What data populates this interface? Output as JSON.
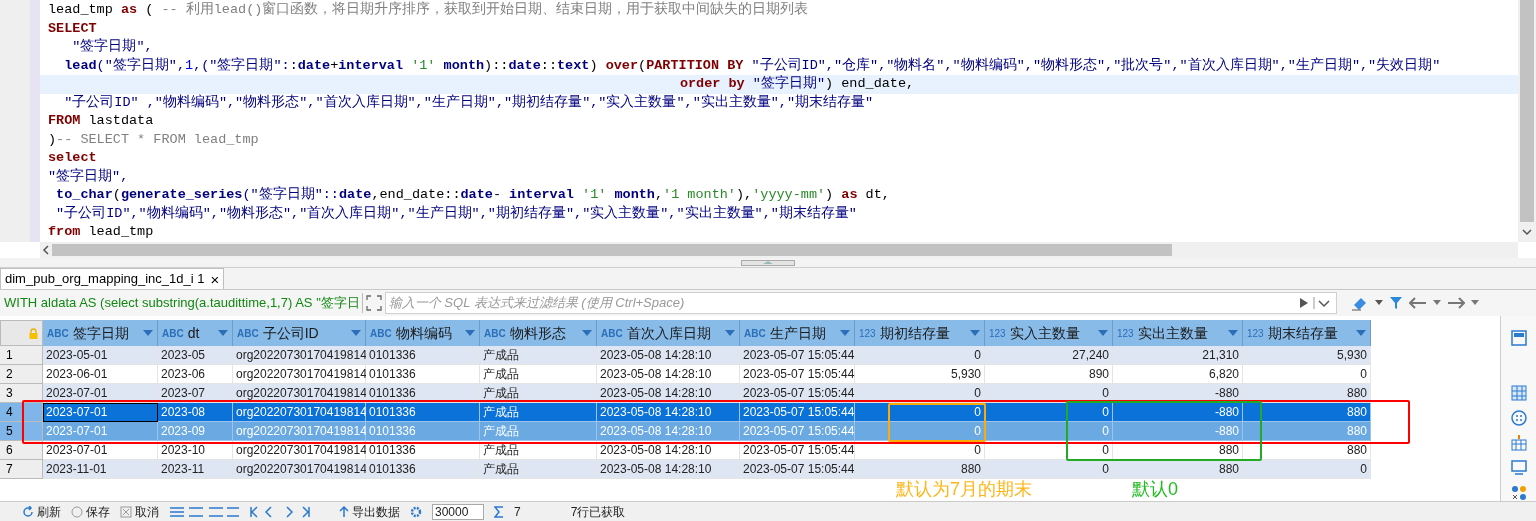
{
  "editor": {
    "lines": [
      {
        "highlighted": false,
        "segments": [
          {
            "kind": "plain",
            "text": "lead_tmp "
          },
          {
            "kind": "kw",
            "text": "as"
          },
          {
            "kind": "plain",
            "text": " ( "
          },
          {
            "kind": "comment",
            "text": "-- 利用lead()窗口函数，将日期升序排序，获取到开始日期、结束日期，用于获取中间缺失的日期列表"
          }
        ]
      },
      {
        "highlighted": false,
        "segments": [
          {
            "kind": "kw",
            "text": "SELECT"
          }
        ]
      },
      {
        "highlighted": false,
        "segments": [
          {
            "kind": "ident",
            "text": "   \"签字日期\","
          }
        ]
      },
      {
        "highlighted": false,
        "segments": [
          {
            "kind": "fn",
            "text": "  lead"
          },
          {
            "kind": "ident",
            "text": "(\"签字日期\","
          },
          {
            "kind": "num",
            "text": "1"
          },
          {
            "kind": "ident",
            "text": ",(\"签字日期\"::"
          },
          {
            "kind": "fn",
            "text": "date"
          },
          {
            "kind": "plain",
            "text": "+"
          },
          {
            "kind": "fn",
            "text": "interval "
          },
          {
            "kind": "str",
            "text": "'1'"
          },
          {
            "kind": "fn",
            "text": " month"
          },
          {
            "kind": "plain",
            "text": ")::"
          },
          {
            "kind": "fn",
            "text": "date"
          },
          {
            "kind": "plain",
            "text": "::"
          },
          {
            "kind": "fn",
            "text": "text"
          },
          {
            "kind": "plain",
            "text": ") "
          },
          {
            "kind": "kw",
            "text": "over"
          },
          {
            "kind": "plain",
            "text": "("
          },
          {
            "kind": "kw",
            "text": "PARTITION BY"
          },
          {
            "kind": "ident",
            "text": " \"子公司ID\",\"仓库\",\"物料名\",\"物料编码\",\"物料形态\",\"批次号\",\"首次入库日期\",\"生产日期\",\"失效日期\""
          }
        ]
      },
      {
        "highlighted": true,
        "segments": [
          {
            "kind": "kw",
            "text": "                                                                              order by"
          },
          {
            "kind": "ident",
            "text": " \"签字日期\""
          },
          {
            "kind": "plain",
            "text": ") end_date,"
          }
        ]
      },
      {
        "highlighted": false,
        "segments": [
          {
            "kind": "ident",
            "text": "  \"子公司ID\" ,\"物料编码\",\"物料形态\",\"首次入库日期\",\"生产日期\",\"期初结存量\",\"实入主数量\",\"实出主数量\",\"期末结存量\""
          }
        ]
      },
      {
        "highlighted": false,
        "segments": [
          {
            "kind": "kw",
            "text": "FROM"
          },
          {
            "kind": "plain",
            "text": " lastdata"
          }
        ]
      },
      {
        "highlighted": false,
        "segments": [
          {
            "kind": "plain",
            "text": ")"
          },
          {
            "kind": "comment",
            "text": "-- SELECT * FROM lead_tmp"
          }
        ]
      },
      {
        "highlighted": false,
        "segments": [
          {
            "kind": "kw",
            "text": "select"
          }
        ]
      },
      {
        "highlighted": false,
        "segments": [
          {
            "kind": "ident",
            "text": "\"签字日期\","
          }
        ]
      },
      {
        "highlighted": false,
        "segments": [
          {
            "kind": "fn",
            "text": " to_char"
          },
          {
            "kind": "plain",
            "text": "("
          },
          {
            "kind": "fn",
            "text": "generate_series"
          },
          {
            "kind": "ident",
            "text": "(\"签字日期\"::"
          },
          {
            "kind": "fn",
            "text": "date"
          },
          {
            "kind": "plain",
            "text": ",end_date::"
          },
          {
            "kind": "fn",
            "text": "date"
          },
          {
            "kind": "plain",
            "text": "- "
          },
          {
            "kind": "fn",
            "text": "interval "
          },
          {
            "kind": "str",
            "text": "'1'"
          },
          {
            "kind": "fn",
            "text": " month"
          },
          {
            "kind": "plain",
            "text": ","
          },
          {
            "kind": "str",
            "text": "'1 month'"
          },
          {
            "kind": "plain",
            "text": "),"
          },
          {
            "kind": "str",
            "text": "'yyyy-mm'"
          },
          {
            "kind": "plain",
            "text": ") "
          },
          {
            "kind": "kw",
            "text": "as"
          },
          {
            "kind": "plain",
            "text": " dt,"
          }
        ]
      },
      {
        "highlighted": false,
        "segments": [
          {
            "kind": "ident",
            "text": " \"子公司ID\",\"物料编码\",\"物料形态\",\"首次入库日期\",\"生产日期\",\"期初结存量\",\"实入主数量\",\"实出主数量\",\"期末结存量\""
          }
        ]
      },
      {
        "highlighted": false,
        "segments": [
          {
            "kind": "kw",
            "text": "from"
          },
          {
            "kind": "plain",
            "text": " lead_tmp"
          }
        ]
      }
    ]
  },
  "result_tab": {
    "label": "dim_pub_org_mapping_inc_1d_i 1",
    "close": "×"
  },
  "filter_bar": {
    "query": "WITH aldata AS (select substring(a.taudittime,1,7) AS \"签字日",
    "placeholder": "输入一个 SQL 表达式来过滤结果 (使用 Ctrl+Space)"
  },
  "table": {
    "columns": [
      {
        "name": "签字日期",
        "type_label": "ABC",
        "kind": "text"
      },
      {
        "name": "dt",
        "type_label": "ABC",
        "kind": "text"
      },
      {
        "name": "子公司ID",
        "type_label": "ABC",
        "kind": "text"
      },
      {
        "name": "物料编码",
        "type_label": "ABC",
        "kind": "text"
      },
      {
        "name": "物料形态",
        "type_label": "ABC",
        "kind": "text"
      },
      {
        "name": "首次入库日期",
        "type_label": "ABC",
        "kind": "text"
      },
      {
        "name": "生产日期",
        "type_label": "ABC",
        "kind": "text"
      },
      {
        "name": "期初结存量",
        "type_label": "123",
        "kind": "number"
      },
      {
        "name": "实入主数量",
        "type_label": "123",
        "kind": "number"
      },
      {
        "name": "实出主数量",
        "type_label": "123",
        "kind": "number"
      },
      {
        "name": "期末结存量",
        "type_label": "123",
        "kind": "number"
      }
    ],
    "rows": [
      {
        "number": "1",
        "selected": false,
        "current": false,
        "cells": [
          "2023-05-01",
          "2023-05",
          "org20220730170419814",
          "0101336",
          "产成品",
          "2023-05-08 14:28:10",
          "2023-05-07 15:05:44",
          "0",
          "27,240",
          "21,310",
          "5,930"
        ]
      },
      {
        "number": "2",
        "selected": false,
        "current": false,
        "cells": [
          "2023-06-01",
          "2023-06",
          "org20220730170419814",
          "0101336",
          "产成品",
          "2023-05-08 14:28:10",
          "2023-05-07 15:05:44",
          "5,930",
          "890",
          "6,820",
          "0"
        ]
      },
      {
        "number": "3",
        "selected": false,
        "current": false,
        "cells": [
          "2023-07-01",
          "2023-07",
          "org20220730170419814",
          "0101336",
          "产成品",
          "2023-05-08 14:28:10",
          "2023-05-07 15:05:44",
          "0",
          "0",
          "-880",
          "880"
        ]
      },
      {
        "number": "4",
        "selected": true,
        "current": true,
        "cells": [
          "2023-07-01",
          "2023-08",
          "org20220730170419814",
          "0101336",
          "产成品",
          "2023-05-08 14:28:10",
          "2023-05-07 15:05:44",
          "0",
          "0",
          "-880",
          "880"
        ]
      },
      {
        "number": "5",
        "selected": true,
        "current": false,
        "cells": [
          "2023-07-01",
          "2023-09",
          "org20220730170419814",
          "0101336",
          "产成品",
          "2023-05-08 14:28:10",
          "2023-05-07 15:05:44",
          "0",
          "0",
          "-880",
          "880"
        ]
      },
      {
        "number": "6",
        "selected": false,
        "current": false,
        "cells": [
          "2023-07-01",
          "2023-10",
          "org20220730170419814",
          "0101336",
          "产成品",
          "2023-05-08 14:28:10",
          "2023-05-07 15:05:44",
          "0",
          "0",
          "880",
          "880"
        ]
      },
      {
        "number": "7",
        "selected": false,
        "current": false,
        "cells": [
          "2023-11-01",
          "2023-11",
          "org20220730170419814",
          "0101336",
          "产成品",
          "2023-05-08 14:28:10",
          "2023-05-07 15:05:44",
          "880",
          "0",
          "880",
          "0"
        ]
      }
    ]
  },
  "annotations": {
    "boxes": [
      {
        "color": "#ff0000"
      },
      {
        "color": "#ffaa00"
      },
      {
        "color": "#22aa22"
      }
    ],
    "labels": [
      {
        "text": "默认为7月的期末",
        "color": "#ffb619"
      },
      {
        "text": "默认0",
        "color": "#22bb22"
      }
    ]
  },
  "bottom_toolbar": {
    "refresh": "刷新",
    "save": "保存",
    "cancel": "取消",
    "export": "导出数据",
    "fetch_size": "30000",
    "row_count": "7",
    "status": "7行已获取"
  }
}
